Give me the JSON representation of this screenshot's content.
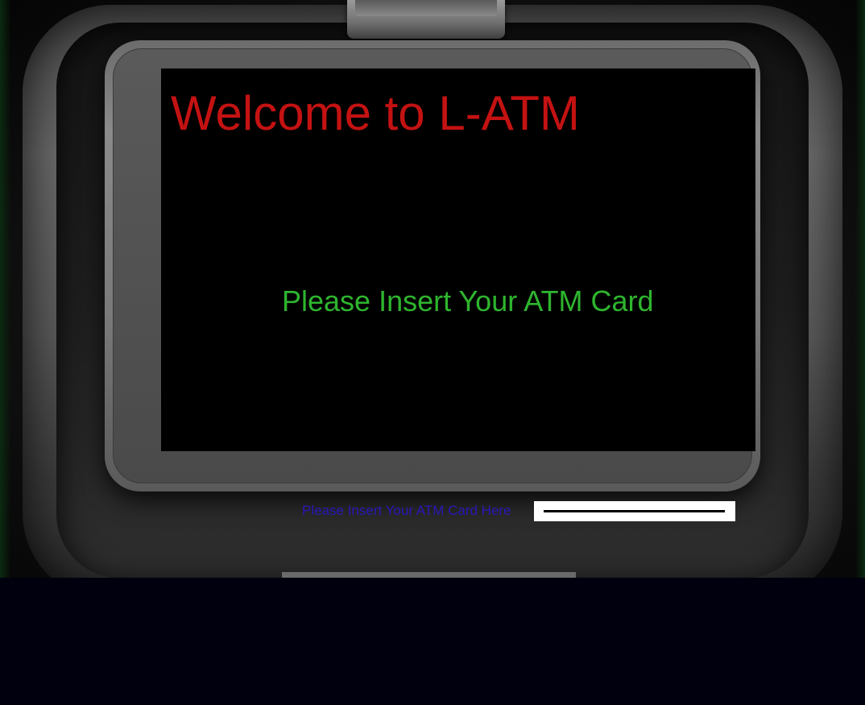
{
  "screen": {
    "title": "Welcome to L-ATM",
    "prompt": "Please Insert Your ATM Card"
  },
  "card_reader": {
    "label": "Please Insert Your ATM Card Here",
    "input_value": ""
  },
  "colors": {
    "title": "#c41212",
    "prompt": "#2eb52e",
    "card_label": "#2a17b8",
    "screen_bg": "#000000",
    "page_bg": "#00000f"
  }
}
